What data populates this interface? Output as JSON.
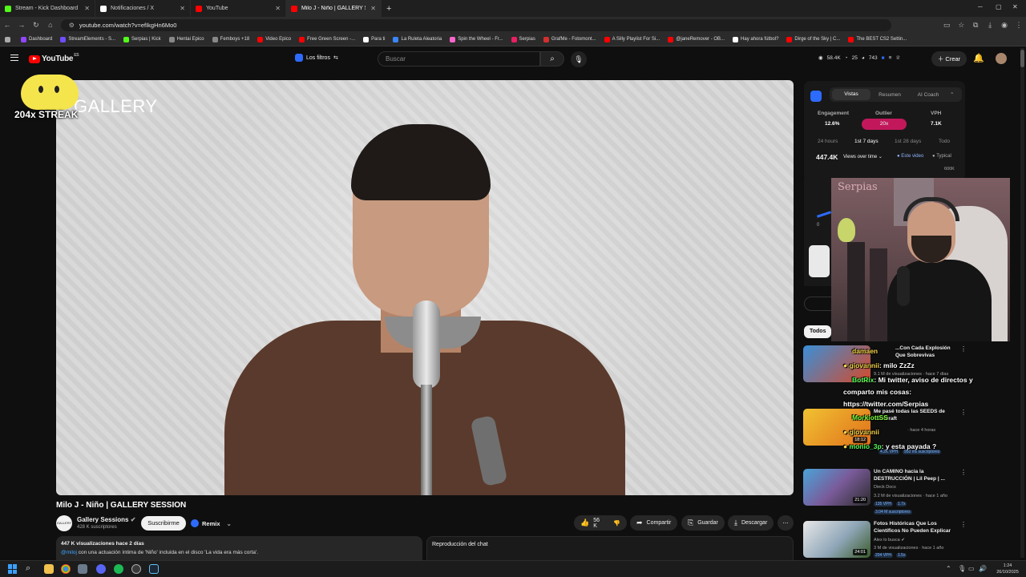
{
  "browser": {
    "tabs": [
      {
        "title": "Stream - Kick Dashboard",
        "color": "#53fc18"
      },
      {
        "title": "Notificaciones / X",
        "color": "#ffffff"
      },
      {
        "title": "YouTube",
        "color": "#ff0000"
      },
      {
        "title": "Milo J - Niño | GALLERY SE...",
        "color": "#ff0000",
        "active": true
      }
    ],
    "url": "youtube.com/watch?v=efIkgHn6Mo0",
    "bookmarks": [
      {
        "label": "Dashboard",
        "color": "#9146ff"
      },
      {
        "label": "StreamElements - S...",
        "color": "#6f4dff"
      },
      {
        "label": "Serpias | Kick",
        "color": "#53fc18"
      },
      {
        "label": "Hentai Epico",
        "color": "#888888"
      },
      {
        "label": "Femboys +18",
        "color": "#888888"
      },
      {
        "label": "Video Epico",
        "color": "#ff0000"
      },
      {
        "label": "Free Green Screen -...",
        "color": "#ff0000"
      },
      {
        "label": "Para ti",
        "color": "#ffffff"
      },
      {
        "label": "La Ruleta Aleatoria",
        "color": "#3a86ff"
      },
      {
        "label": "Spin the Wheel - Fr...",
        "color": "#ff66cc"
      },
      {
        "label": "Serpias",
        "color": "#e91e63"
      },
      {
        "label": "GrafMe - Fotomont...",
        "color": "#d32f2f"
      },
      {
        "label": "A Silly Playlist For Si...",
        "color": "#ff0000"
      },
      {
        "label": "@janeRemover - OB...",
        "color": "#ff0000"
      },
      {
        "label": "Hay ahora fútbol?",
        "color": "#ffffff"
      },
      {
        "label": "Dirge of the Sky | C...",
        "color": "#ff0000"
      },
      {
        "label": "The BEST CS2 Settin...",
        "color": "#ff0000"
      }
    ]
  },
  "header": {
    "logo_text": "YouTube",
    "logo_country": "ES",
    "filters_label": "Los filtros",
    "search_placeholder": "Buscar",
    "stats": [
      "58.4K",
      "25",
      "743"
    ],
    "create_label": "Crear"
  },
  "video": {
    "overlay_text": "GALLERY",
    "title": "Milo J - Niño | GALLERY SESSION",
    "channel_name": "Gallery Sessions",
    "channel_avatar_text": "GALLERY",
    "subscribers": "428 K suscriptores",
    "subscribe_label": "Suscribirme",
    "remix_label": "Remix",
    "likes": "56 K",
    "share_label": "Compartir",
    "save_label": "Guardar",
    "download_label": "Descargar",
    "desc_stats": "447 K visualizaciones  hace 2 días",
    "desc_mention": "@miloj",
    "desc_text": " con una actuación íntima de 'Niño' incluida en el disco 'La vida era más corta'.",
    "chat_replay_label": "Reproducción del chat"
  },
  "streak": {
    "text": "204x STREAK"
  },
  "extension": {
    "tabs": [
      "Vistas",
      "Resumen",
      "AI Coach"
    ],
    "metrics": [
      {
        "label": "Engagement",
        "value": "12.6%"
      },
      {
        "label": "Outlier",
        "value": "20x"
      },
      {
        "label": "VPH",
        "value": "7.1K"
      }
    ],
    "ranges": [
      "24 hours",
      "1st 7 days",
      "1st 28 days",
      "Todo"
    ],
    "views": "447.4K",
    "views_mode": "Views over time",
    "legend": [
      "Este video",
      "Typical"
    ],
    "axis_top": "600K",
    "axis_zero": "0"
  },
  "recs": {
    "chip_all": "Todos",
    "items": [
      {
        "title": "...Con Cada Explosión Que Sobrevivas",
        "channel": "",
        "meta": "9.1 M de visualizaciones · hace 7 días",
        "duration": "",
        "thumb": "#d44a2a"
      },
      {
        "title": "Me pasé todas las SEEDS de Minecraft",
        "channel": "",
        "meta": "· hace 4 horas",
        "duration": "18:12",
        "extra": [
          "4.2K VPH",
          "950 mil suscriptores"
        ],
        "thumb": "#e8a21b"
      },
      {
        "title": "Un CAMINO hacia la DESTRUCCIÓN | Lil Peep | ...",
        "channel": "Dieck Docs",
        "meta": "3.2 M de visualizaciones · hace 1 año",
        "duration": "21:20",
        "extra": [
          "135 VPH",
          "1.7x",
          "3.04 M suscriptores"
        ],
        "thumb": "#7a5b9a"
      },
      {
        "title": "Fotos Históricas Que Los Científicos No Pueden Explicar",
        "channel": "Alex lo busca",
        "meta": "3 M de visualizaciones · hace 1 año",
        "duration": "24:01",
        "extra": [
          "204 VPH",
          "1.5x"
        ],
        "thumb": "#8fa6b8"
      }
    ]
  },
  "chat": [
    {
      "user": "damaen",
      "text": ""
    },
    {
      "user": "giovannii",
      "text": ": milo ZzZz"
    },
    {
      "user": "BotRix",
      "text": ": Mi twitter, aviso de directos y"
    },
    {
      "user": "",
      "text": "comparto mis cosas:"
    },
    {
      "user": "",
      "text": "https://twitter.com/Serpias"
    },
    {
      "user": "MorkiottSS",
      "text": ""
    },
    {
      "user": "giovannii",
      "text": ""
    },
    {
      "user": "monio_3p",
      "text": ": y esta payada ?"
    }
  ],
  "webcam": {
    "neon_text": "Serpias"
  },
  "taskbar": {
    "time": "1:24",
    "date": "26/10/2025"
  }
}
